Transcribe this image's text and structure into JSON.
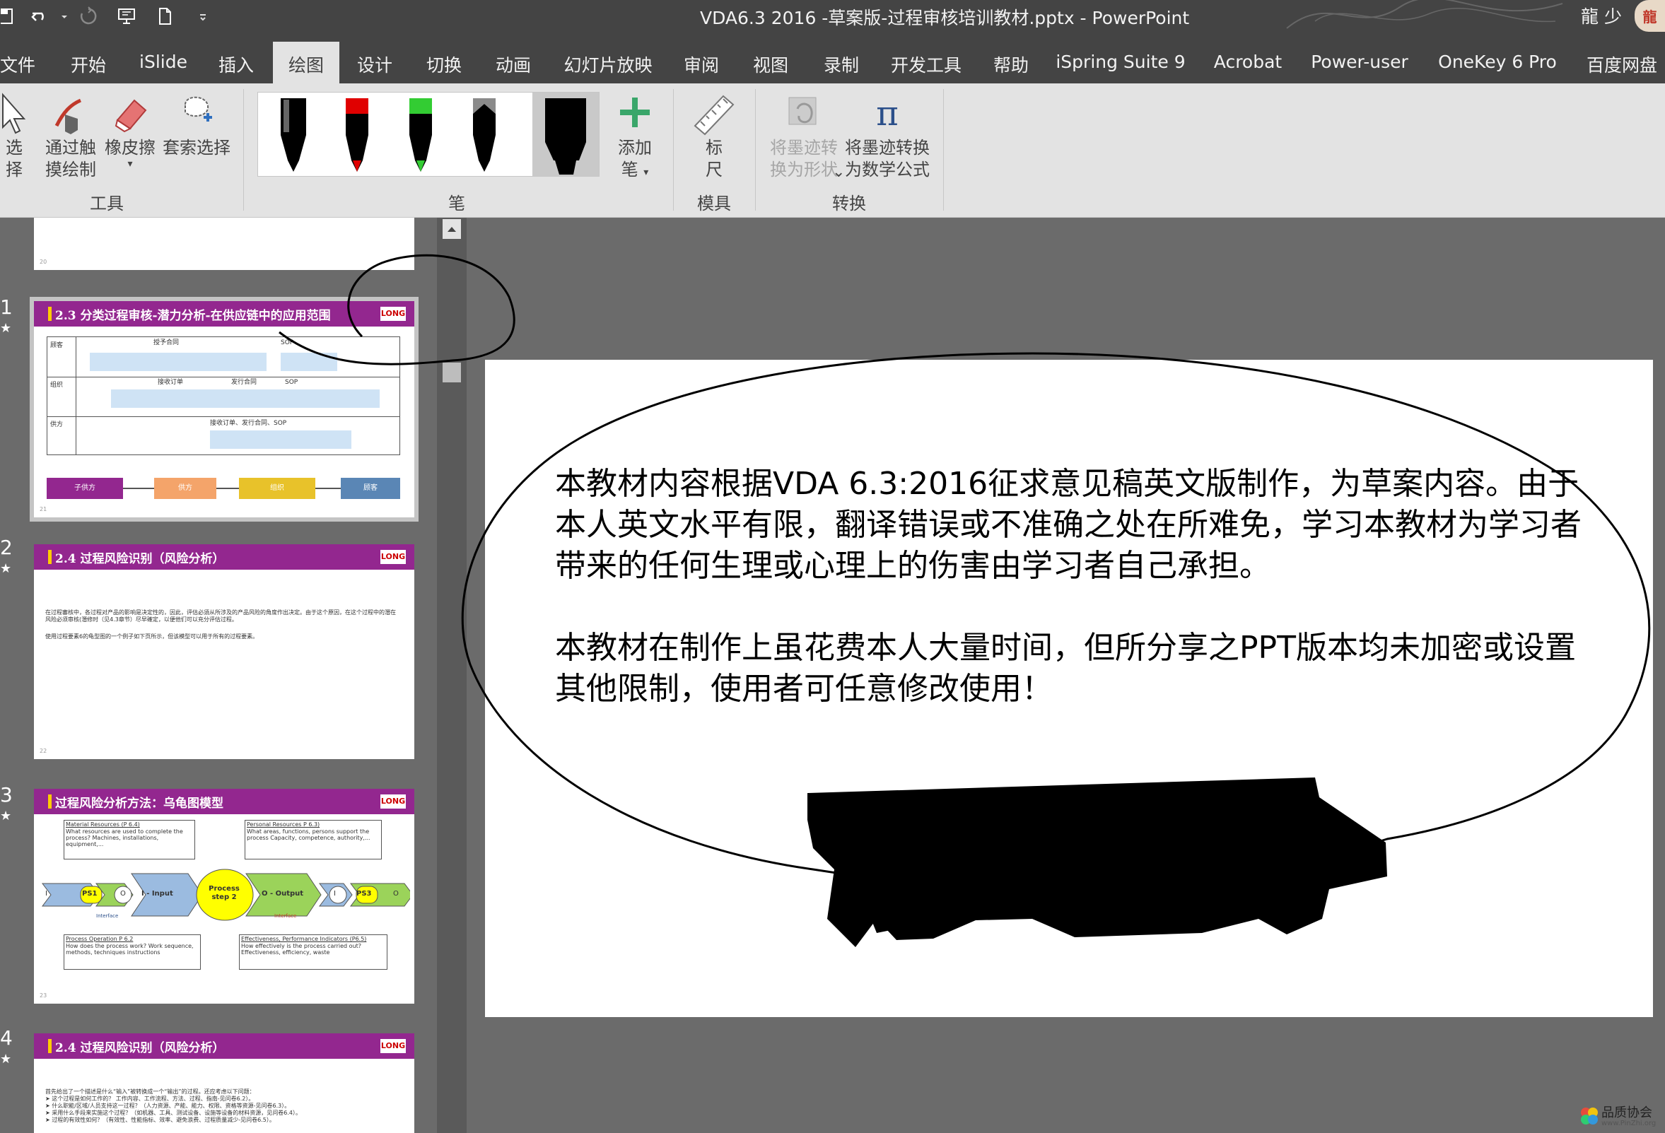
{
  "window": {
    "title": "VDA6.3 2016 -草案版-过程审核培训教材.pptx  -  PowerPoint",
    "user": "龍 少",
    "avatar_text": "龍"
  },
  "tabs": [
    {
      "label": "文件"
    },
    {
      "label": "开始"
    },
    {
      "label": "iSlide"
    },
    {
      "label": "插入"
    },
    {
      "label": "绘图"
    },
    {
      "label": "设计"
    },
    {
      "label": "切换"
    },
    {
      "label": "动画"
    },
    {
      "label": "幻灯片放映"
    },
    {
      "label": "审阅"
    },
    {
      "label": "视图"
    },
    {
      "label": "录制"
    },
    {
      "label": "开发工具"
    },
    {
      "label": "帮助"
    },
    {
      "label": "iSpring Suite 9"
    },
    {
      "label": "Acrobat"
    },
    {
      "label": "Power-user"
    },
    {
      "label": "OneKey 6 Pro"
    },
    {
      "label": "百度网盘"
    }
  ],
  "active_tab": "绘图",
  "ribbon": {
    "tools": {
      "group_label": "工具",
      "select_label_1": "选",
      "select_label_2": "择",
      "touch_draw_1": "通过触",
      "touch_draw_2": "摸绘制",
      "eraser": "橡皮擦",
      "lasso": "套索选择"
    },
    "pens": {
      "group_label": "笔",
      "add_pen_1": "添加",
      "add_pen_2": "笔",
      "colors": [
        "#000000",
        "#e00000",
        "#33cc33",
        "#8a8a8a",
        "#000000"
      ]
    },
    "stencils": {
      "group_label": "模具",
      "ruler_1": "标",
      "ruler_2": "尺"
    },
    "convert": {
      "group_label": "转换",
      "ink_to_shape_1": "将墨迹转",
      "ink_to_shape_2": "换为形状",
      "ink_to_math_1": "将墨迹转换",
      "ink_to_math_2": "为数学公式",
      "math_glyph": "π"
    }
  },
  "thumbnails": [
    {
      "number": "",
      "page": "20"
    },
    {
      "number": "1",
      "star": "★",
      "title": "2.3 分类过程审核-潜力分析-在供应链中的应用范围",
      "logo": "LONG",
      "rows": [
        "顾客",
        "组织",
        "供方"
      ],
      "legend": [
        "子供方",
        "供方",
        "组织",
        "顾客"
      ],
      "labels": {
        "award": "授予合同",
        "sop": "SOP",
        "receive": "接收订单",
        "issue": "发行合同",
        "supplier_line": "接收订单、发行合同、SOP"
      },
      "page": "21"
    },
    {
      "number": "2",
      "star": "★",
      "title": "2.4 过程风险识别（风险分析）",
      "logo": "LONG",
      "body": "在过程審核中，各过程对产品的影响是决定性的，因此，评估必須从所涉及的产品风险的角度作出决定。由于这个原因，在这个过程中的潛在风险必须审核(潛修时（见4.3章节）尽早確定，以便他们可以充分评估过程。",
      "body2": "使用过程要素6的龟型图的一个例子如下页所示，但该模型可以用于所有的过程要素。",
      "page": "22"
    },
    {
      "number": "3",
      "star": "★",
      "title": "过程风险分析方法：乌龟图模型",
      "logo": "LONG",
      "material_title": "Material Resources (P 6.4)",
      "material_body": "What resources are used to complete the process? Machines, installations, equipment,...",
      "personal_title": "Personal Resources P 6.3)",
      "personal_body": "What areas, functions, persons support the process Capacity, competence, authority,...",
      "process_operation_title": "Process Operation P 6.2",
      "process_operation_body": "How does the process work? Work sequence, methods, techniques instructions",
      "effectiveness_title": "Effectiveness, Performance Indicators (P6.5)",
      "effectiveness_body": "How effectively is the process carried out? Effectiveness, efficiency, waste",
      "center": "Process step 2",
      "input": "I - Input",
      "output": "O - Output",
      "ps1": "PS1",
      "ps3": "PS3",
      "i": "I",
      "o": "O",
      "interface": "Interface",
      "page": "23"
    },
    {
      "number": "4",
      "star": "★",
      "title": "2.4 过程风险识别（风险分析）",
      "logo": "LONG",
      "lines": [
        "首先给出了一个描述是什么“输入”被转换成一个“输出”的过程。还应考虑以下问题：",
        "➤ 这个过程是如何工作的？ 工作内容、工作流程、方法、过程、指南-见问卷6.2）。",
        "➤ 什么职能/区域/人员支持这一过程？（人力资源、产能、能力、权限、资格等资源-见问卷6.3）。",
        "➤ 采用什么手段来实施这个过程？（如机器、工具、测试设备、设施等设备的材料资源，见问卷6.4）。",
        "➤ 过程的有效性如何？（有效性、性能指标、效率、避免浪费、过程质量减少-见问卷6.5）。"
      ]
    }
  ],
  "slide": {
    "paragraph1": "本教材内容根据VDA 6.3:2016征求意见稿英文版制作，为草案内容。由于本人英文水平有限，翻译错误或不准确之处在所难免，学习本教材为学习者带来的任何生理或心理上的伤害由学习者自己承担。",
    "paragraph2": "本教材在制作上虽花费本人大量时间，但所分享之PPT版本均未加密或设置其他限制，使用者可任意修改使用！"
  },
  "watermark_logo": {
    "line1": "品质协会",
    "line2": "www.PinZhi.org"
  },
  "colors": {
    "title_bar": "#444444",
    "ribbon": "#e3e3e3",
    "slide_header": "#93278f"
  }
}
